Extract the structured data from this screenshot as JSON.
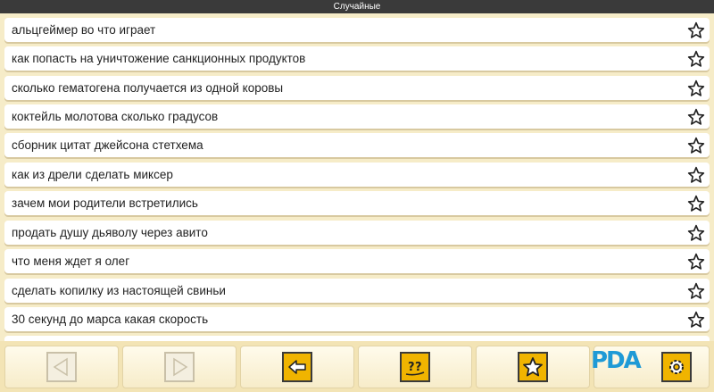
{
  "header": {
    "title": "Случайные"
  },
  "list": {
    "items": [
      {
        "label": "альцгеймер во что играет"
      },
      {
        "label": "как попасть на уничтожение санкционных продуктов"
      },
      {
        "label": "сколько гематогена получается из одной коровы"
      },
      {
        "label": "коктейль молотова сколько градусов"
      },
      {
        "label": "сборник цитат джейсона стетхема"
      },
      {
        "label": "как из дрели сделать миксер"
      },
      {
        "label": "зачем мои родители встретились"
      },
      {
        "label": "продать душу дьяволу через авито"
      },
      {
        "label": "что меня ждет я олег"
      },
      {
        "label": "сделать копилку из настоящей свиньи"
      },
      {
        "label": "30 секунд до марса какая скорость"
      }
    ]
  },
  "toolbar": {
    "buttons": [
      {
        "icon": "arrow-left-outline-icon",
        "state": "disabled"
      },
      {
        "icon": "arrow-right-outline-icon",
        "state": "disabled"
      },
      {
        "icon": "back-arrow-icon",
        "state": "active"
      },
      {
        "icon": "random-question-icon",
        "state": "active"
      },
      {
        "icon": "favorites-star-icon",
        "state": "active"
      },
      {
        "icon": "settings-gear-icon",
        "state": "active"
      }
    ]
  },
  "watermark": {
    "text": "PDA",
    "icon": "4pda-logo-icon"
  },
  "colors": {
    "background": "#f6ecc8",
    "titlebar": "#3a3a3a",
    "accent": "#f0b400",
    "row": "#ffffff"
  }
}
